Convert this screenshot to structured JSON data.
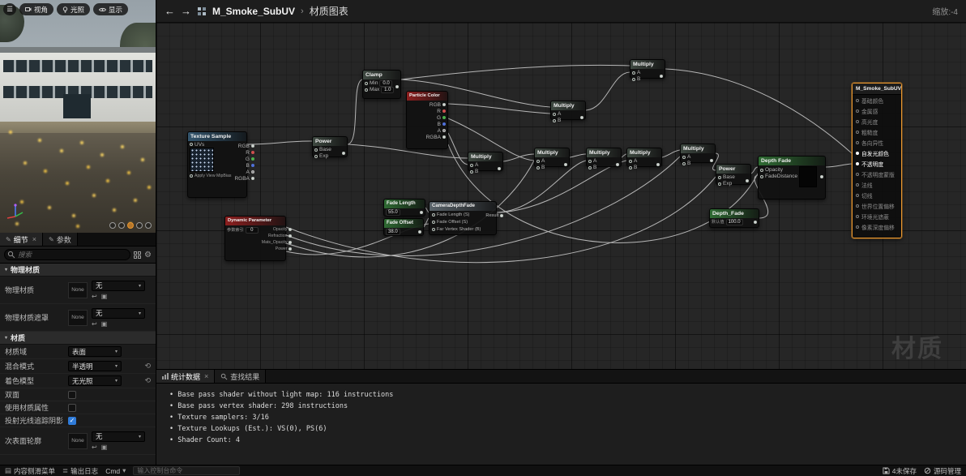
{
  "icons": {
    "menu": "☰",
    "chevron_down": "▾",
    "gear": "⚙",
    "close": "×",
    "back": "←",
    "forward": "→",
    "reset": "⟲",
    "check": "✓",
    "use_asset": "↩",
    "browse": "▣",
    "pencil": "✎",
    "drawer": "▤",
    "log": "≣"
  },
  "viewport": {
    "perspective_label": "视角",
    "lit_label": "光照",
    "show_label": "显示"
  },
  "details": {
    "tab_details": "细节",
    "tab_params": "参数",
    "search_placeholder": "搜索",
    "section_physical": "物理材质",
    "section_material": "材质",
    "rows": {
      "phys_material": {
        "label": "物理材质",
        "thumb": "None",
        "value": "无"
      },
      "phys_mask": {
        "label": "物理材质遮罩",
        "thumb": "None",
        "value": "无"
      },
      "domain": {
        "label": "材质域",
        "value": "表面"
      },
      "blend": {
        "label": "混合模式",
        "value": "半透明"
      },
      "shading": {
        "label": "着色模型",
        "value": "无光照"
      },
      "two_sided": {
        "label": "双面"
      },
      "use_attrs": {
        "label": "使用材质属性"
      },
      "cast_shadows": {
        "label": "投射光线追踪阴影"
      },
      "subsurface": {
        "label": "次表面轮廓",
        "thumb": "None",
        "value": "无"
      }
    }
  },
  "graph": {
    "breadcrumb_title": "M_Smoke_SubUV",
    "breadcrumb_sep": "›",
    "breadcrumb_sub": "材质图表",
    "zoom_label": "缩放:-4",
    "watermark": "材质",
    "labels": {
      "multiply": "Multiply",
      "power": "Power",
      "clamp": "Clamp",
      "particle_color": "Particle Color",
      "texture_sample": "Texture Sample",
      "dynamic_parameter": "Dynamic Parameter",
      "fade_length": "Fade Length",
      "fade_offset": "Fade Offset",
      "camera_depth_fade": "CameraDepthFade",
      "depth_fade": "Depth Fade",
      "depth_fade_param": "Depth_Fade",
      "result_title": "M_Smoke_SubUV",
      "pin_a": "A",
      "pin_b": "B",
      "pin_base": "Base",
      "pin_exp": "Exp",
      "pin_min": "Min",
      "pin_max": "Max",
      "pin_uvs": "UVs",
      "pin_mip": "Apply View MipBias",
      "pin_rgb": "RGB",
      "pin_r": "R",
      "pin_g": "G",
      "pin_b_out": "B",
      "pin_alpha": "A",
      "pin_rgba": "RGBA",
      "pin_opacity": "Opacity",
      "pin_fade_distance": "FadeDistance",
      "pin_result": "Result",
      "cdf_in_length": "Fade Length (S)",
      "cdf_in_offset": "Fade Offset (S)",
      "cdf_in_far": "Far Vertex Shader (B)",
      "default_value": "默认值",
      "param_index": "参数索引"
    },
    "values": {
      "clamp_min": "0.0",
      "clamp_max": "1.0",
      "fade_length_value": "55.0",
      "fade_offset_value": "38.0",
      "depth_fade_value": "100.0",
      "param_index_value": "0"
    },
    "dyn_outputs": [
      "Opacity",
      "Refraction",
      "Mats_Opacity",
      "Power"
    ],
    "result_inputs": [
      {
        "label": "基础颜色",
        "on": false
      },
      {
        "label": "金属感",
        "on": false
      },
      {
        "label": "高光度",
        "on": false
      },
      {
        "label": "粗糙度",
        "on": false
      },
      {
        "label": "各向异性",
        "on": false
      },
      {
        "label": "自发光颜色",
        "on": true
      },
      {
        "label": "不透明度",
        "on": true
      },
      {
        "label": "不透明度蒙版",
        "on": false
      },
      {
        "label": "法线",
        "on": false
      },
      {
        "label": "切线",
        "on": false
      },
      {
        "label": "世界位置偏移",
        "on": false
      },
      {
        "label": "环境光遮蔽",
        "on": false
      },
      {
        "label": "像素深度偏移",
        "on": false
      }
    ]
  },
  "stats_panel": {
    "tab_stats": "统计数据",
    "tab_find": "查找结果",
    "lines": [
      "Base pass shader without light map: 116 instructions",
      "Base pass vertex shader: 298 instructions",
      "Texture samplers: 3/16",
      "Texture Lookups (Est.): VS(0), PS(6)",
      "Shader Count: 4"
    ]
  },
  "statusbar": {
    "content_drawer": "内容侧滑菜单",
    "output_log": "输出日志",
    "cmd": "Cmd",
    "console_placeholder": "输入控制台命令",
    "unsaved": "4未保存",
    "source_control": "源码管理"
  },
  "colors": {
    "accent_orange": "#e8962e",
    "checkbox_blue": "#2f7bd8",
    "node_red_header": "#8d1f1f",
    "node_green_header": "#2f6b33"
  }
}
